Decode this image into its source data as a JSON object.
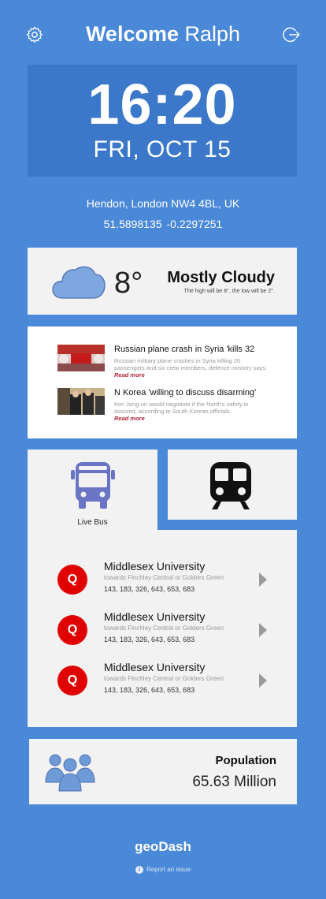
{
  "header": {
    "welcome_prefix": "Welcome",
    "user_name": "Ralph",
    "settings_icon": "gear-icon",
    "logout_icon": "logout-icon"
  },
  "clock": {
    "time": "16:20",
    "date": "FRI, OCT 15"
  },
  "location": {
    "address": "Hendon, London NW4 4BL, UK",
    "coordinates": "51.5898135  -0.2297251"
  },
  "weather": {
    "icon": "cloud-icon",
    "temperature": "8°",
    "condition": "Mostly Cloudy",
    "summary": "The high will be 8°, the low will be 2°."
  },
  "news": {
    "items": [
      {
        "title": "Russian plane crash in Syria 'kills 32",
        "description": "Russian military plane crashes in Syria killing 26 passengers and six crew members, defence ministry says.",
        "more": "Read more"
      },
      {
        "title": "N Korea 'willing to discuss disarming'",
        "description": "Kim Jong-un would negotiate if the North's safety is assured, according to South Korean officials.",
        "more": "Read more"
      }
    ]
  },
  "transport": {
    "bus_label": "Live Bus",
    "bus_icon": "bus-icon",
    "train_icon": "train-icon",
    "stops": [
      {
        "badge": "Q",
        "name": "Middlesex University",
        "direction": "towards Finchley Central or Golders Green",
        "routes": "143, 183, 326, 643, 653, 683"
      },
      {
        "badge": "Q",
        "name": "Middlesex University",
        "direction": "towards Finchley Central or Golders Green",
        "routes": "143, 183, 326, 643, 653, 683"
      },
      {
        "badge": "Q",
        "name": "Middlesex University",
        "direction": "towards Finchley Central or Golders Green",
        "routes": "143, 183, 326, 643, 653, 683"
      }
    ]
  },
  "population": {
    "icon": "people-icon",
    "title": "Population",
    "value": "65.63 Million"
  },
  "footer": {
    "brand": "geoDash",
    "report_label": "Report an issue"
  },
  "colors": {
    "background": "#4a88d8",
    "clock_panel": "#3b78c9",
    "card": "#f2f2f2",
    "stop_badge": "#e10000",
    "read_more": "#b0253a",
    "transport_icon": "#6a74c4"
  }
}
